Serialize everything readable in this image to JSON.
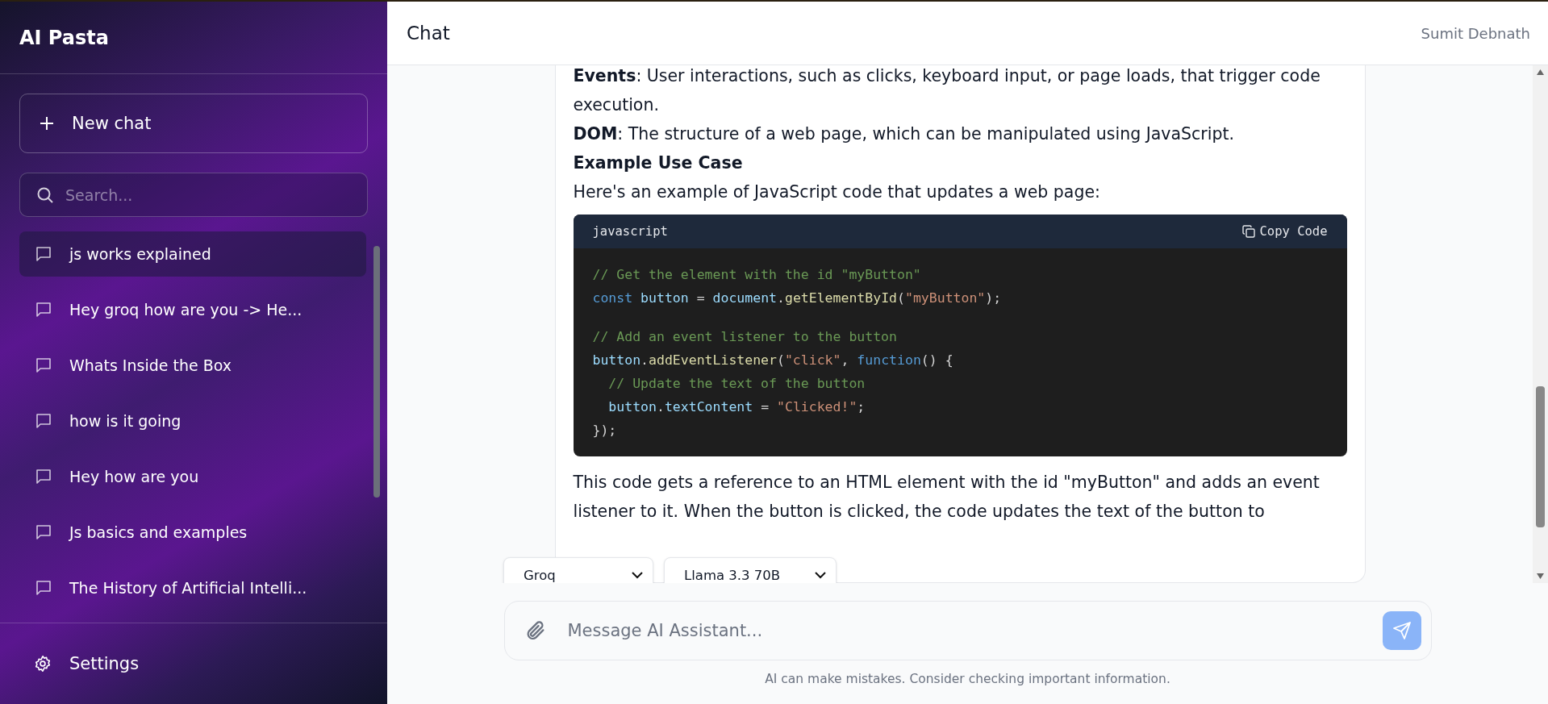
{
  "sidebar": {
    "title": "AI Pasta",
    "new_chat": "New chat",
    "search": {
      "placeholder": "Search..."
    },
    "items": [
      {
        "label": "js works explained",
        "selected": true
      },
      {
        "label": "Hey groq how are you -> He...",
        "selected": false
      },
      {
        "label": "Whats Inside the Box",
        "selected": false
      },
      {
        "label": "how is it going",
        "selected": false
      },
      {
        "label": "Hey how are you",
        "selected": false
      },
      {
        "label": "Js basics and examples",
        "selected": false
      },
      {
        "label": "The History of Artificial Intelli...",
        "selected": false
      }
    ],
    "settings": "Settings"
  },
  "header": {
    "title": "Chat",
    "user": "Sumit Debnath"
  },
  "message": {
    "blocks": [
      {
        "kind": "paragraph",
        "text": "**Events**: User interactions, such as clicks, keyboard input, or page loads, that trigger code execution."
      },
      {
        "kind": "paragraph",
        "text": "**DOM**: The structure of a web page, which can be manipulated using JavaScript."
      },
      {
        "kind": "heading",
        "text": "Example Use Case"
      },
      {
        "kind": "paragraph",
        "text": "Here's an example of JavaScript code that updates a web page:"
      },
      {
        "kind": "code",
        "language": "javascript",
        "copy": "Copy Code",
        "lines": [
          {
            "tokens": [
              {
                "kind": "comment",
                "text": "// Get the element with the id \"myButton\""
              }
            ]
          },
          {
            "tokens": [
              {
                "kind": "keyword",
                "text": "const"
              },
              {
                "kind": "var",
                "text": " button"
              },
              {
                "kind": "plain",
                "text": " = "
              },
              {
                "kind": "var",
                "text": "document"
              },
              {
                "kind": "plain",
                "text": "."
              },
              {
                "kind": "func",
                "text": "getElementById"
              },
              {
                "kind": "plain",
                "text": "("
              },
              {
                "kind": "string",
                "text": "\"myButton\""
              },
              {
                "kind": "plain",
                "text": ");"
              }
            ]
          },
          {
            "gap_before": true,
            "tokens": [
              {
                "kind": "comment",
                "text": "// Add an event listener to the button"
              }
            ]
          },
          {
            "tokens": [
              {
                "kind": "var",
                "text": "button"
              },
              {
                "kind": "plain",
                "text": "."
              },
              {
                "kind": "func",
                "text": "addEventListener"
              },
              {
                "kind": "plain",
                "text": "("
              },
              {
                "kind": "string",
                "text": "\"click\""
              },
              {
                "kind": "plain",
                "text": ", "
              },
              {
                "kind": "keyword",
                "text": "function"
              },
              {
                "kind": "plain",
                "text": "() {"
              }
            ]
          },
          {
            "tokens": [
              {
                "kind": "comment",
                "text": "  // Update the text of the button"
              }
            ]
          },
          {
            "tokens": [
              {
                "kind": "var",
                "text": "  button"
              },
              {
                "kind": "plain",
                "text": "."
              },
              {
                "kind": "var",
                "text": "textContent"
              },
              {
                "kind": "plain",
                "text": " = "
              },
              {
                "kind": "string",
                "text": "\"Clicked!\""
              },
              {
                "kind": "plain",
                "text": ";"
              }
            ]
          },
          {
            "tokens": [
              {
                "kind": "plain",
                "text": "});"
              }
            ]
          }
        ]
      },
      {
        "kind": "paragraph",
        "text": "This code gets a reference to an HTML element with the id \"myButton\" and adds an event listener to it. When the button is clicked, the code updates the text of the button to"
      }
    ]
  },
  "selectors": [
    {
      "value": "Groq"
    },
    {
      "value": "Llama 3.3 70B"
    }
  ],
  "composer": {
    "placeholder": "Message AI Assistant..."
  },
  "disclaimer": "AI can make mistakes. Consider checking important information."
}
